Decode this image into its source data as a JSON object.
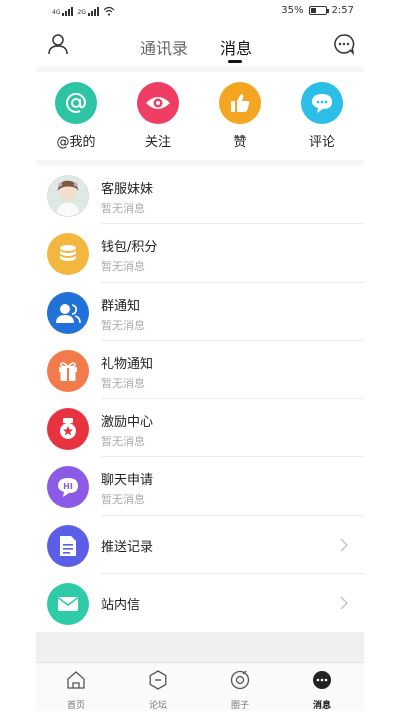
{
  "status_bar": {
    "battery": "35%",
    "time": "2:57",
    "net_label_1": "4G",
    "net_label_2": "2G",
    "battery_level": 0.35
  },
  "header": {
    "tabs": [
      {
        "label": "通讯录"
      },
      {
        "label": "消息"
      }
    ],
    "active_tab": "消息"
  },
  "quick_actions": [
    {
      "label": "@我的",
      "icon": "at-icon",
      "color": "#2cc4a3"
    },
    {
      "label": "关注",
      "icon": "eye-icon",
      "color": "#ef3d63"
    },
    {
      "label": "赞",
      "icon": "thumbs-up-icon",
      "color": "#f4a623"
    },
    {
      "label": "评论",
      "icon": "comment-icon",
      "color": "#2bbfe8"
    }
  ],
  "messages": [
    {
      "title": "客服妹妹",
      "subtitle": "暂无消息",
      "icon": "avatar-photo"
    },
    {
      "title": "钱包/积分",
      "subtitle": "暂无消息",
      "icon": "coins-icon",
      "color": "#f3b73f"
    },
    {
      "title": "群通知",
      "subtitle": "暂无消息",
      "icon": "group-icon",
      "color": "#2271d8"
    },
    {
      "title": "礼物通知",
      "subtitle": "暂无消息",
      "icon": "gift-icon",
      "color": "#f37a4b"
    },
    {
      "title": "激励中心",
      "subtitle": "暂无消息",
      "icon": "medal-icon",
      "color": "#e8323f"
    },
    {
      "title": "聊天申请",
      "subtitle": "暂无消息",
      "icon": "chat-hi-icon",
      "color": "#8b5be8"
    },
    {
      "title": "推送记录",
      "icon": "document-icon",
      "color": "#5b5ee6"
    },
    {
      "title": "站内信",
      "icon": "mail-icon",
      "color": "#2fcba8"
    }
  ],
  "bottom_nav": [
    {
      "label": "首页",
      "icon": "home-icon"
    },
    {
      "label": "论坛",
      "icon": "forum-icon"
    },
    {
      "label": "圈子",
      "icon": "circle-icon"
    },
    {
      "label": "消息",
      "icon": "message-icon",
      "active": true
    }
  ]
}
